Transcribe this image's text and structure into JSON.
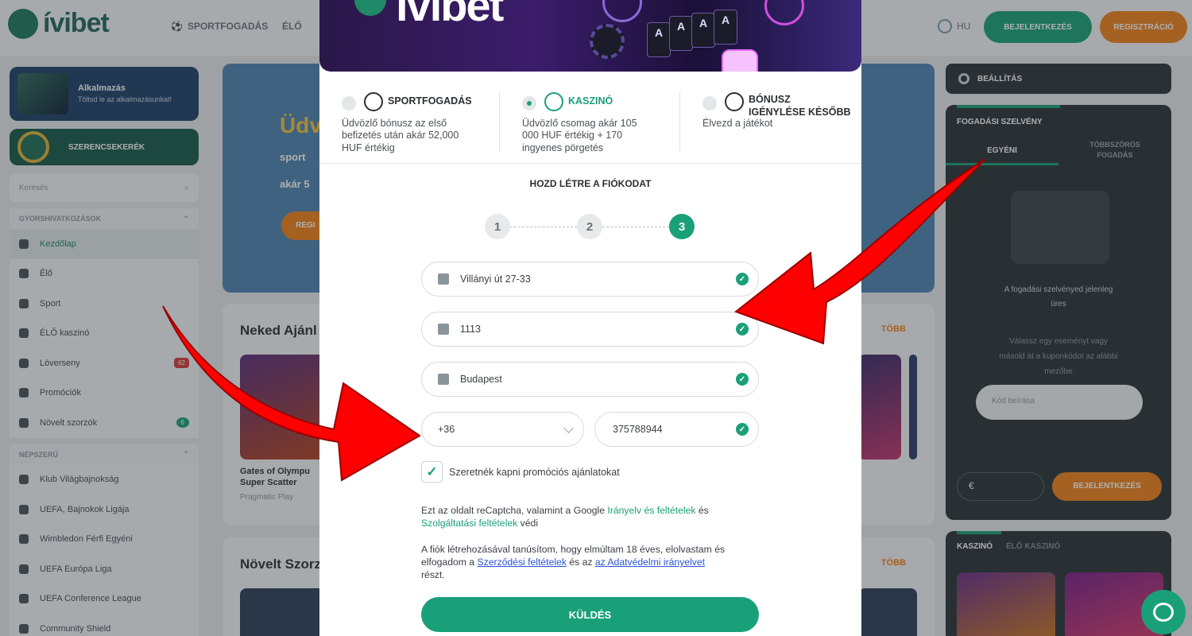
{
  "header": {
    "logo_text": "ívibet",
    "nav_sport": "SPORTFOGADÁS",
    "nav_elo": "ÉLŐ",
    "lang": "HU",
    "login_label": "BEJELENTKEZÉS",
    "register_label": "REGISZTRÁCIÓ"
  },
  "sidebar": {
    "app_title": "Alkalmazás",
    "app_sub": "Töltsd le az alkalmazásunkat!",
    "wheel_label": "SZERENCSEKERÉK",
    "search_placeholder": "Keresés",
    "section_quick": "GYORSHIVATKOZÁSOK",
    "section_popular": "NÉPSZERŰ",
    "items": [
      {
        "label": "Kezdőlap"
      },
      {
        "label": "Élő"
      },
      {
        "label": "Sport"
      },
      {
        "label": "ÉLŐ kaszinó"
      },
      {
        "label": "Lóverseny",
        "badge": "62"
      },
      {
        "label": "Promóciók"
      },
      {
        "label": "Növelt szorzók",
        "badge": "6"
      }
    ],
    "popular": [
      {
        "label": "Klub Világbajnokság"
      },
      {
        "label": "UEFA, Bajnokok Ligája"
      },
      {
        "label": "Wimbledon Férfi Egyéni"
      },
      {
        "label": "UEFA Európa Liga"
      },
      {
        "label": "UEFA Conference League"
      },
      {
        "label": "Community Shield"
      }
    ]
  },
  "banner": {
    "headline": "Üdv",
    "line1": "sport",
    "line2": "akár 5",
    "button": "REGI"
  },
  "sections": {
    "recommended_title": "Neked Ajánl",
    "boosted_title": "Növelt Szorz",
    "more_label": "TÖBB",
    "game_name_1": "Gates of Olympu",
    "game_name_2": "Super Scatter",
    "game_provider": "Pragmatic Play"
  },
  "right_panel": {
    "settings_label": "BEÁLLÍTÁS",
    "betslip_title": "FOGADÁSI SZELVÉNY",
    "tab_single": "EGYÉNI",
    "tab_combo_1": "TÖBBSZÖRÖS",
    "tab_combo_2": "FOGADÁS",
    "empty_1": "A fogadási szelvényed jelenleg",
    "empty_2": "üres",
    "hint_1": "Válassz egy eseményt vagy",
    "hint_2": "másold át a kuponkódot az alábbi",
    "hint_3": "mezőbe",
    "code_placeholder": "Kód beírása",
    "currency": "€",
    "signin_label": "BEJELENTKEZÉS",
    "casino_tab": "KASZINÓ",
    "live_casino_tab": "ÉLŐ KASZINÓ"
  },
  "modal": {
    "hero_logo": "ívibet",
    "bonus_options": [
      {
        "title": "SPORTFOGADÁS",
        "desc": "Üdvözlő bónusz az első befizetés után akár 52,000 HUF érték ig",
        "desc_1": "Üdvözlő bónusz az első",
        "desc_2": "befizetés után akár 52,000",
        "desc_3": "HUF értékig",
        "selected": false
      },
      {
        "title": "KASZINÓ",
        "desc_1": "Üdvözlő csomag akár 105",
        "desc_2": "000 HUF értékig + 170",
        "desc_3": "ingyenes pörgetés",
        "selected": true
      },
      {
        "title_1": "BÓNUSZ",
        "title_2": "IGÉNYLÉSE KÉSŐBB",
        "desc_1": "Élvezd a játékot",
        "selected": false
      }
    ],
    "form_title": "HOZD LÉTRE A FIÓKODAT",
    "steps": [
      "1",
      "2",
      "3"
    ],
    "active_step": 3,
    "fields": {
      "address": "Villányi út 27-33",
      "zip": "1113",
      "city": "Budapest",
      "phone_prefix": "+36",
      "phone": "375788944"
    },
    "promo_label": "Szeretnék kapni promóciós ajánlatokat",
    "promo_checked": true,
    "recaptcha_1": "Ezt az oldalt reCaptcha, valamint a Google ",
    "recaptcha_link1": "Irányelv és feltételek",
    "recaptcha_2": " és",
    "recaptcha_link2": "Szolgáltatási feltételek",
    "recaptcha_3": " védi",
    "terms_1": "A fiók létrehozásával tanúsítom, hogy elmúltam 18 éves, elolvastam és elfogadom a ",
    "terms_link1": "Szerződési feltételek",
    "terms_2": " és az ",
    "terms_link2": "az Adatvédelmi irányelvet",
    "terms_3": "részt.",
    "submit_label": "KÜLDÉS"
  },
  "colors": {
    "brand_green": "#1aa078",
    "orange": "#f0821a",
    "arrow_red": "#ff0000"
  }
}
